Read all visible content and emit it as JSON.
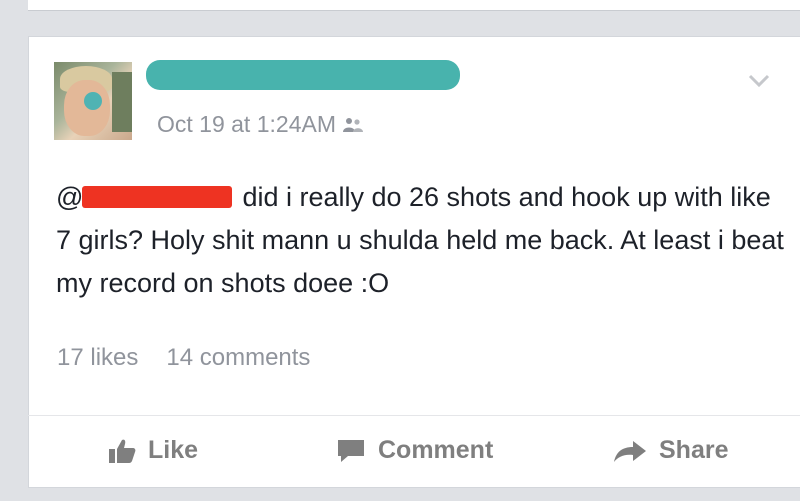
{
  "post": {
    "timestamp": "Oct 19 at 1:24AM",
    "mention_prefix": "@d",
    "text_after_mention": "did i really do 26 shots and hook up with like 7 girls? Holy shit mann u shulda held me back. At least i beat my record on shots doee :O",
    "likes": "17 likes",
    "comments": "14 comments"
  },
  "actions": {
    "like_label": "Like",
    "comment_label": "Comment",
    "share_label": "Share"
  },
  "icons": {
    "audience": "friends-icon",
    "menu": "chevron-down-icon",
    "like": "thumbs-up-icon",
    "comment": "speech-bubble-icon",
    "share": "share-arrow-icon"
  },
  "colors": {
    "name_redaction": "#48b3ad",
    "mention_redaction": "#ee3322",
    "meta_text": "#90949c",
    "body_text": "#1d2129"
  }
}
